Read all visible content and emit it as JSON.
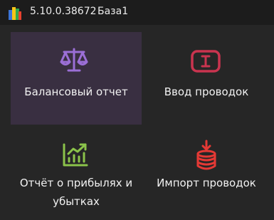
{
  "titlebar": {
    "version": "5.10.0.38672",
    "database": "База1"
  },
  "tiles": [
    {
      "label": "Балансовый отчет",
      "icon": "scales-icon",
      "color": "#9b6fd6",
      "selected": true
    },
    {
      "label": "Ввод проводок",
      "icon": "input-cursor-icon",
      "color": "#c9344f",
      "selected": false
    },
    {
      "label": "Отчёт о прибылях и убытках",
      "label_line1": "Отчёт о прибылях и",
      "label_line2": "убытках",
      "icon": "growth-chart-icon",
      "color": "#8bc34a",
      "selected": false
    },
    {
      "label": "Импорт проводок",
      "icon": "database-import-icon",
      "color": "#e53935",
      "selected": false
    }
  ],
  "colors": {
    "background": "#262626",
    "titlebar": "#1c1c1c",
    "selected_tile": "#392f41"
  }
}
